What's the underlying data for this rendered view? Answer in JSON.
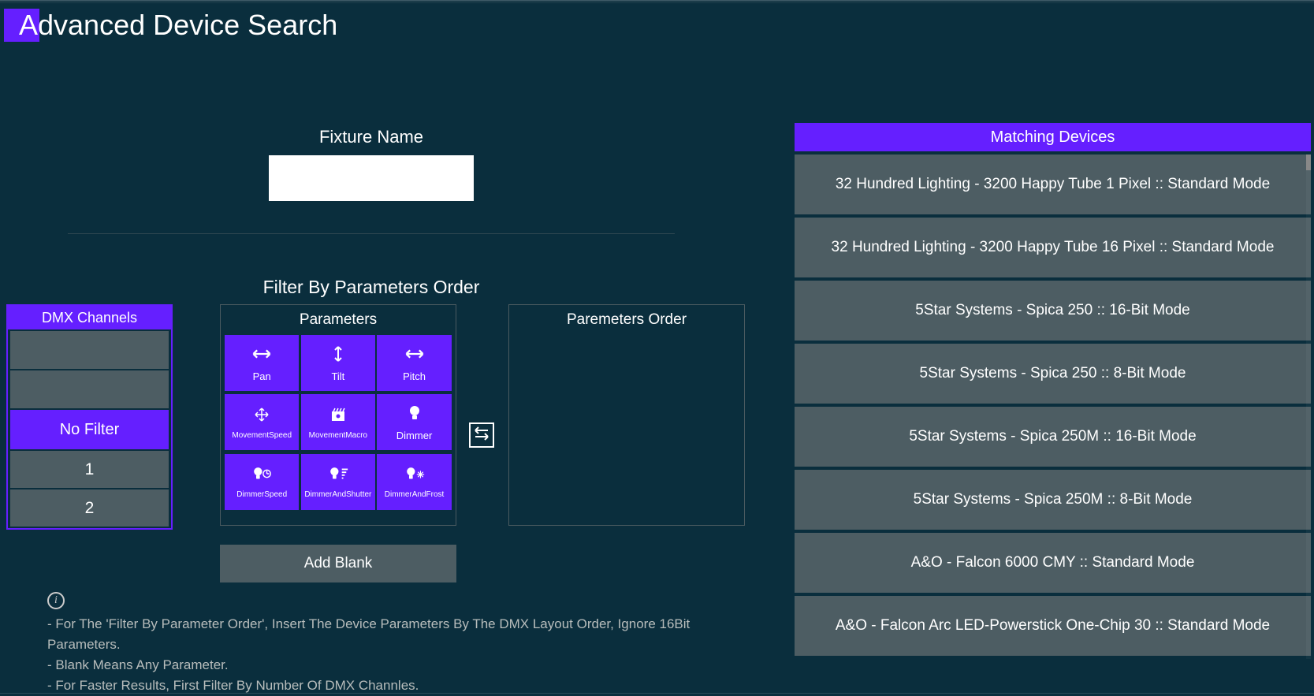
{
  "title": "Advanced Device Search",
  "fixture": {
    "label": "Fixture Name",
    "value": ""
  },
  "filter_heading": "Filter By Parameters Order",
  "dmx": {
    "header": "DMX Channels",
    "no_filter": "No Filter",
    "rows": [
      "1",
      "2"
    ]
  },
  "parameters": {
    "header": "Parameters",
    "tiles": [
      {
        "id": "pan",
        "label": "Pan"
      },
      {
        "id": "tilt",
        "label": "Tilt"
      },
      {
        "id": "pitch",
        "label": "Pitch"
      },
      {
        "id": "movement-speed",
        "label": "MovementSpeed"
      },
      {
        "id": "movement-macro",
        "label": "MovementMacro"
      },
      {
        "id": "dimmer",
        "label": "Dimmer"
      },
      {
        "id": "dimmer-speed",
        "label": "DimmerSpeed"
      },
      {
        "id": "dimmer-and-shutter",
        "label": "DimmerAndShutter"
      },
      {
        "id": "dimmer-and-frost",
        "label": "DimmerAndFrost"
      }
    ],
    "add_blank": "Add Blank"
  },
  "order": {
    "header": "Paremeters Order"
  },
  "info": {
    "lines": [
      "- For The 'Filter By Parameter Order', Insert The Device Parameters By The DMX Layout Order, Ignore 16Bit Parameters.",
      "- Blank Means Any Parameter.",
      "- For Faster Results, First Filter By Number Of DMX Channles."
    ]
  },
  "matching": {
    "header": "Matching Devices",
    "devices": [
      "32 Hundred Lighting - 3200 Happy Tube 1 Pixel :: Standard Mode",
      "32 Hundred Lighting - 3200 Happy Tube 16 Pixel :: Standard Mode",
      "5Star Systems - Spica 250 :: 16-Bit Mode",
      "5Star Systems - Spica 250 :: 8-Bit Mode",
      "5Star Systems - Spica 250M :: 16-Bit Mode",
      "5Star Systems - Spica 250M :: 8-Bit Mode",
      "A&O - Falcon 6000 CMY :: Standard Mode",
      "A&O - Falcon Arc LED-Powerstick One-Chip 30 :: Standard Mode"
    ]
  }
}
